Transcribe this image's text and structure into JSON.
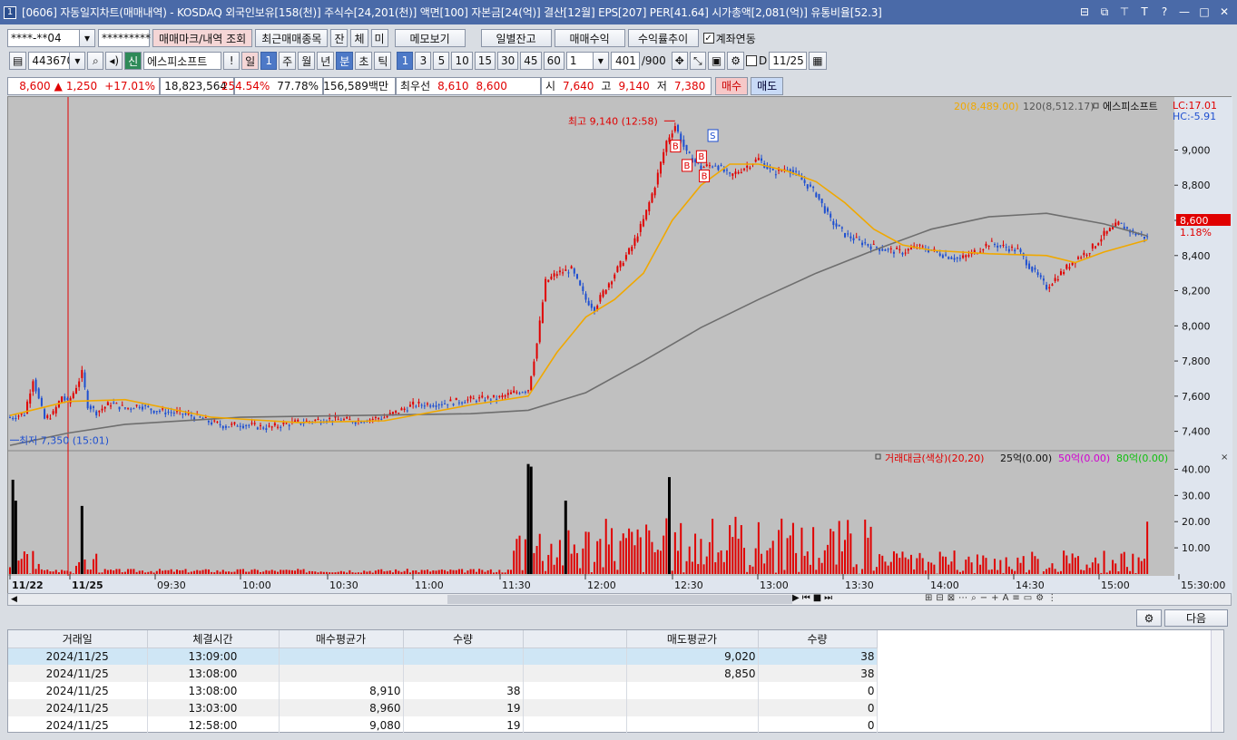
{
  "window": {
    "title": "[0606] 자동일지차트(매매내역) - KOSDAQ 외국인보유[158(천)] 주식수[24,201(천)] 액면[100] 자본금[24(억)] 결산[12월] EPS[207] PER[41.64] 시가총액[2,081(억)] 유통비율[52.3]",
    "number_icon": "1"
  },
  "toolbar1": {
    "account": "****-**04",
    "password": "*********",
    "btn_trade_mark": "매매마크/내역 조회",
    "btn_recent": "최근매매종목",
    "btn_jan": "잔",
    "btn_che": "체",
    "btn_mi": "미",
    "btn_memo": "메모보기",
    "btn_daily_balance": "일별잔고",
    "btn_trade_profit": "매매수익",
    "btn_return_trend": "수익률추이",
    "account_link_label": "계좌연동"
  },
  "toolbar2": {
    "code": "443670",
    "shin": "신",
    "stock_name": "에스피소프트",
    "excl": "!",
    "periods": [
      "일",
      "1",
      "주",
      "월",
      "년",
      "분",
      "초",
      "틱"
    ],
    "intervals": [
      "1",
      "3",
      "5",
      "10",
      "15",
      "30",
      "45",
      "60"
    ],
    "interval_input": "1",
    "count": "401",
    "count_max": "/900",
    "d_label": "D",
    "date": "11/25"
  },
  "quote": {
    "price": "8,600",
    "arrow": "▲",
    "change": "1,250",
    "change_pct": "+17.01%",
    "volume": "18,823,564",
    "vol_ratio": "254.54%",
    "rate2": "77.78%",
    "amount": "156,589백만",
    "best_label": "최우선",
    "best_ask": "8,610",
    "best_bid": "8,600",
    "open_label": "시",
    "open": "7,640",
    "high_label": "고",
    "high": "9,140",
    "low_label": "저",
    "low": "7,380",
    "buy": "매수",
    "sell": "매도"
  },
  "chart_data": {
    "type": "line",
    "title": "",
    "legend": {
      "ma20": "20(8,489.00)",
      "ma120": "120(8,512.17)",
      "name": "에스피소프트"
    },
    "lc": "LC:17.01",
    "hc": "HC:-5.91",
    "current_price_tag": "8,600",
    "current_pct_tag": "1.18%",
    "high_annotation": "최고 9,140 (12:58)",
    "low_annotation": "최저 7,350 (15:01)",
    "y_ticks": [
      "9,000",
      "8,800",
      "8,600",
      "8,400",
      "8,200",
      "8,000",
      "7,800",
      "7,600",
      "7,400"
    ],
    "y_tick_values": [
      9000,
      8800,
      8600,
      8400,
      8200,
      8000,
      7800,
      7600,
      7400
    ],
    "ylim": [
      7300,
      9250
    ],
    "x_ticks": [
      "11/22",
      "11/25",
      "09:30",
      "10:00",
      "10:30",
      "11:00",
      "11:30",
      "12:00",
      "12:30",
      "13:00",
      "13:30",
      "14:00",
      "14:30",
      "15:00",
      "15:30:00"
    ],
    "price_path": [
      [
        0,
        7480
      ],
      [
        5,
        7500
      ],
      [
        8,
        7700
      ],
      [
        10,
        7580
      ],
      [
        12,
        7470
      ],
      [
        15,
        7500
      ],
      [
        18,
        7600
      ],
      [
        20,
        7560
      ],
      [
        22,
        7620
      ],
      [
        25,
        7730
      ],
      [
        27,
        7550
      ],
      [
        30,
        7510
      ],
      [
        35,
        7560
      ],
      [
        40,
        7530
      ],
      [
        45,
        7550
      ],
      [
        50,
        7520
      ],
      [
        55,
        7510
      ],
      [
        60,
        7500
      ],
      [
        65,
        7480
      ],
      [
        70,
        7450
      ],
      [
        75,
        7430
      ],
      [
        80,
        7440
      ],
      [
        85,
        7430
      ],
      [
        90,
        7420
      ],
      [
        95,
        7440
      ],
      [
        100,
        7450
      ],
      [
        110,
        7470
      ],
      [
        120,
        7460
      ],
      [
        130,
        7480
      ],
      [
        140,
        7550
      ],
      [
        150,
        7560
      ],
      [
        160,
        7580
      ],
      [
        170,
        7590
      ],
      [
        175,
        7620
      ],
      [
        180,
        7640
      ],
      [
        183,
        7900
      ],
      [
        186,
        8250
      ],
      [
        190,
        8300
      ],
      [
        195,
        8320
      ],
      [
        200,
        8150
      ],
      [
        203,
        8100
      ],
      [
        207,
        8220
      ],
      [
        212,
        8350
      ],
      [
        216,
        8450
      ],
      [
        220,
        8600
      ],
      [
        224,
        8800
      ],
      [
        228,
        9050
      ],
      [
        231,
        9140
      ],
      [
        235,
        8980
      ],
      [
        240,
        8900
      ],
      [
        245,
        8920
      ],
      [
        250,
        8850
      ],
      [
        255,
        8900
      ],
      [
        260,
        8950
      ],
      [
        265,
        8870
      ],
      [
        270,
        8900
      ],
      [
        275,
        8830
      ],
      [
        280,
        8750
      ],
      [
        285,
        8600
      ],
      [
        290,
        8520
      ],
      [
        295,
        8480
      ],
      [
        300,
        8450
      ],
      [
        305,
        8430
      ],
      [
        310,
        8420
      ],
      [
        315,
        8450
      ],
      [
        320,
        8430
      ],
      [
        325,
        8400
      ],
      [
        330,
        8380
      ],
      [
        335,
        8420
      ],
      [
        340,
        8470
      ],
      [
        345,
        8450
      ],
      [
        350,
        8430
      ],
      [
        355,
        8320
      ],
      [
        360,
        8220
      ],
      [
        365,
        8300
      ],
      [
        370,
        8380
      ],
      [
        375,
        8430
      ],
      [
        380,
        8520
      ],
      [
        385,
        8580
      ],
      [
        390,
        8530
      ],
      [
        395,
        8500
      ]
    ],
    "ma20_path": [
      [
        0,
        7490
      ],
      [
        20,
        7570
      ],
      [
        40,
        7580
      ],
      [
        70,
        7480
      ],
      [
        100,
        7450
      ],
      [
        130,
        7460
      ],
      [
        160,
        7550
      ],
      [
        180,
        7600
      ],
      [
        190,
        7850
      ],
      [
        200,
        8050
      ],
      [
        210,
        8150
      ],
      [
        220,
        8300
      ],
      [
        230,
        8600
      ],
      [
        240,
        8800
      ],
      [
        250,
        8920
      ],
      [
        260,
        8920
      ],
      [
        270,
        8880
      ],
      [
        280,
        8820
      ],
      [
        290,
        8700
      ],
      [
        300,
        8550
      ],
      [
        310,
        8460
      ],
      [
        320,
        8430
      ],
      [
        340,
        8410
      ],
      [
        360,
        8400
      ],
      [
        370,
        8360
      ],
      [
        380,
        8420
      ],
      [
        395,
        8489
      ]
    ],
    "ma120_path": [
      [
        0,
        7320
      ],
      [
        20,
        7390
      ],
      [
        40,
        7440
      ],
      [
        80,
        7480
      ],
      [
        120,
        7490
      ],
      [
        160,
        7500
      ],
      [
        180,
        7520
      ],
      [
        200,
        7620
      ],
      [
        220,
        7800
      ],
      [
        240,
        7990
      ],
      [
        260,
        8150
      ],
      [
        280,
        8300
      ],
      [
        300,
        8430
      ],
      [
        320,
        8550
      ],
      [
        340,
        8620
      ],
      [
        360,
        8640
      ],
      [
        380,
        8580
      ],
      [
        395,
        8512
      ]
    ],
    "trade_marks": [
      {
        "label": "B",
        "t": 231,
        "price": 9020
      },
      {
        "label": "B",
        "t": 235,
        "price": 8910
      },
      {
        "label": "B",
        "t": 240,
        "price": 8960
      },
      {
        "label": "B",
        "t": 241,
        "price": 8850
      },
      {
        "label": "S",
        "t": 244,
        "price": 9080
      }
    ],
    "volume_panel": {
      "title": "거래대금(색상)(20,20)",
      "thresholds": [
        "25억(0.00)",
        "50억(0.00)",
        "80억(0.00)"
      ],
      "y_ticks": [
        "40.00",
        "30.00",
        "20.00",
        "10.00"
      ],
      "y_tick_values": [
        40,
        30,
        20,
        10
      ],
      "ylim": [
        0,
        45
      ],
      "big_bars": [
        [
          1,
          36
        ],
        [
          2,
          28
        ],
        [
          25,
          26
        ],
        [
          180,
          42
        ],
        [
          181,
          41
        ],
        [
          193,
          28
        ],
        [
          229,
          37
        ]
      ],
      "bursts": [
        [
          0,
          10,
          12
        ],
        [
          22,
          30,
          10
        ],
        [
          175,
          300,
          22
        ],
        [
          300,
          395,
          9
        ]
      ],
      "last_bar": 20
    }
  },
  "bottom_bar": {
    "next": "다음"
  },
  "table": {
    "headers": [
      "거래일",
      "체결시간",
      "매수평균가",
      "수량",
      "",
      "매도평균가",
      "수량"
    ],
    "rows": [
      [
        "2024/11/25",
        "13:09:00",
        "",
        "",
        "",
        "9,020",
        "38"
      ],
      [
        "2024/11/25",
        "13:08:00",
        "",
        "",
        "",
        "8,850",
        "38"
      ],
      [
        "2024/11/25",
        "13:08:00",
        "8,910",
        "38",
        "",
        "",
        "0"
      ],
      [
        "2024/11/25",
        "13:03:00",
        "8,960",
        "19",
        "",
        "",
        "0"
      ],
      [
        "2024/11/25",
        "12:58:00",
        "9,080",
        "19",
        "",
        "",
        "0"
      ]
    ]
  },
  "colors": {
    "up": "#e00000",
    "down": "#1e4fd0",
    "ma20": "#f0a800",
    "ma120": "#6e6e6e"
  }
}
